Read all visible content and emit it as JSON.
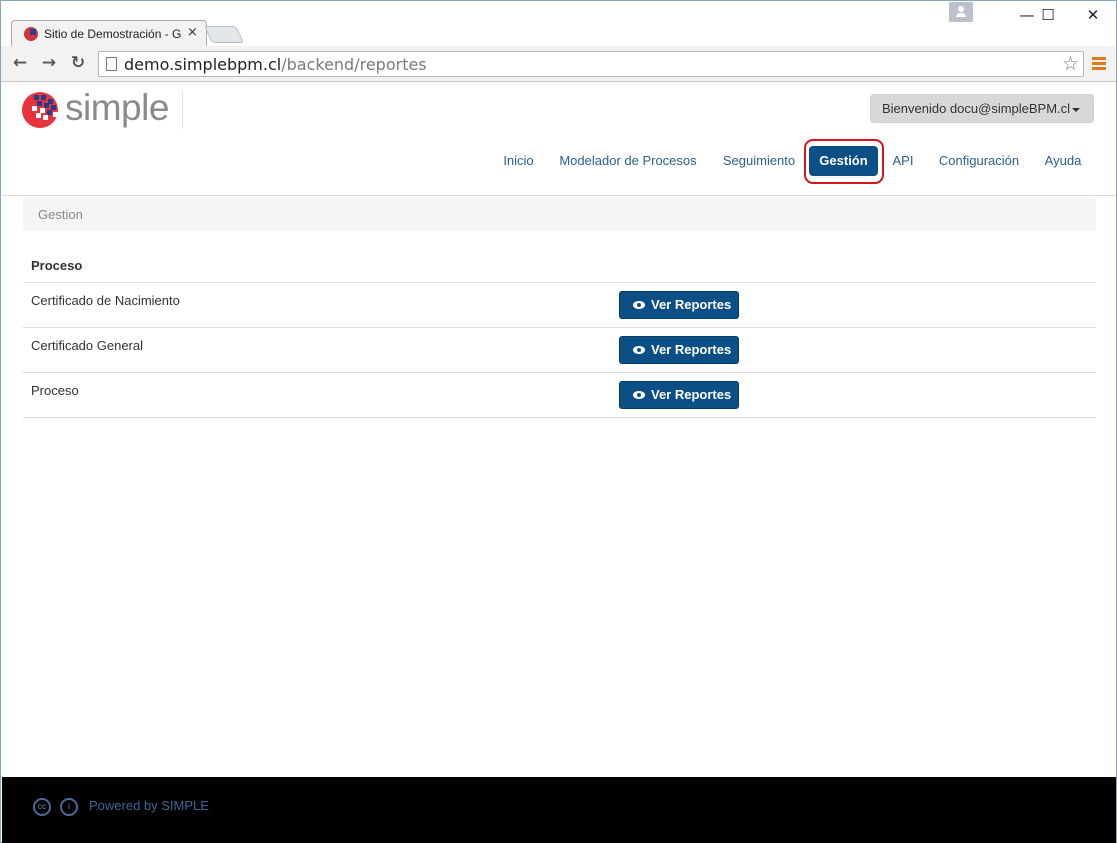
{
  "browser": {
    "tab_title": "Sitio de Demostración - G",
    "tab_close": "×",
    "url_host": "demo.simplebpm.cl",
    "url_path": "/backend/reportes",
    "minimize": "—",
    "maximize": "☐",
    "close": "✕",
    "back": "←",
    "forward": "→",
    "reload": "↻",
    "bookmark": "☆"
  },
  "header": {
    "logo_text": "simple",
    "user_menu": "Bienvenido docu@simpleBPM.cl"
  },
  "nav": {
    "items": [
      {
        "label": "Inicio"
      },
      {
        "label": "Modelador de Procesos"
      },
      {
        "label": "Seguimiento"
      },
      {
        "label": "Gestión"
      },
      {
        "label": "API"
      },
      {
        "label": "Configuración"
      },
      {
        "label": "Ayuda"
      }
    ],
    "active": "Gestión"
  },
  "breadcrumb": "Gestion",
  "table": {
    "header": "Proceso",
    "rows": [
      {
        "name": "Certificado de Nacimiento",
        "action": "Ver Reportes"
      },
      {
        "name": "Certificado General",
        "action": "Ver Reportes"
      },
      {
        "name": "Proceso",
        "action": "Ver Reportes"
      }
    ]
  },
  "footer": {
    "cc_label": "cc",
    "by_label": "i",
    "text": "Powered by SIMPLE"
  },
  "colors": {
    "brand_blue": "#0c4f87",
    "logo_red": "#e8323c",
    "highlight": "#d4151c",
    "footer_bg": "#000000"
  }
}
